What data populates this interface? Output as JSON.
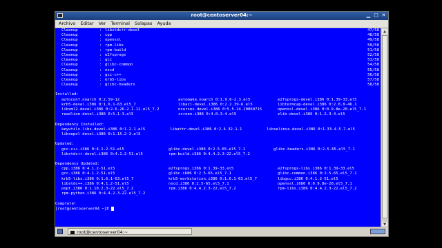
{
  "window": {
    "title": "root@centoserver04:~",
    "menu": [
      "Archivo",
      "Editar",
      "Ver",
      "Terminal",
      "Solapas",
      "Ayuda"
    ]
  },
  "terminal": {
    "cleanup": [
      [
        "Cleanup",
        ":",
        "libstdc++-devel",
        "47/58"
      ],
      [
        "Cleanup",
        ":",
        "cpp",
        "48/58"
      ],
      [
        "Cleanup",
        ":",
        "openssl",
        "49/58"
      ],
      [
        "Cleanup",
        ":",
        "rpm-libs",
        "50/58"
      ],
      [
        "Cleanup",
        ":",
        "rpm-build",
        "51/58"
      ],
      [
        "Cleanup",
        ":",
        "e2fsprogs",
        "52/58"
      ],
      [
        "Cleanup",
        ":",
        "gcc",
        "53/58"
      ],
      [
        "Cleanup",
        ":",
        "glibc-common",
        "54/58"
      ],
      [
        "Cleanup",
        ":",
        "nscd",
        "55/58"
      ],
      [
        "Cleanup",
        ":",
        "gcc-c++",
        "56/58"
      ],
      [
        "Cleanup",
        ":",
        "krb5-libs",
        "57/58"
      ],
      [
        "Cleanup",
        ":",
        "glibc-headers",
        "58/58"
      ]
    ],
    "installed_header": "Installed:",
    "installed": [
      [
        "autoconf.noarch 0:2.59-12",
        "automake.noarch 0:1.9.6-2.3.el5",
        "e2fsprogs-devel.i386 0:1.39-33.el5"
      ],
      [
        "krb5-devel.i386 0:1.6.1-63.el5_7",
        "libacl-devel.i386 0:2.2.39-6.el5",
        "libtermcap-devel.i386 0:2.0.8-46.1"
      ],
      [
        "libxml2-devel.i386 0:2.6.26-2.1.12.el5_7.2",
        "ncurses-devel.i386 0:5.5-24.20060715",
        "openssl-devel.i386 0:0.9.8e-20.el5_7.1"
      ],
      [
        "readline-devel.i386 0:5.1-3.el5",
        "screen.i386 0:4.0.3-4.el5",
        "zlib-devel.i386 0:1.2.3-4.el5"
      ]
    ],
    "dep_installed_header": "Dependency Installed:",
    "dep_installed": [
      [
        "keyutils-libs-devel.i386 0:1.2-1.el5",
        "libattr-devel.i386 0:2.4.32-1.1",
        "libselinux-devel.i386 0:1.33.4-5.7.el5"
      ],
      [
        "libsepol-devel.i386 0:1.15.2-3.el5",
        "",
        ""
      ]
    ],
    "updated_header": "Updated:",
    "updated": [
      [
        "gcc-c++.i386 0:4.1.2-51.el5",
        "glibc-devel.i386 0:2.5-65.el5_7.1",
        "glibc-headers.i386 0:2.5-65.el5_7.1"
      ],
      [
        "libstdc++-devel.i386 0:4.1.2-51.el5",
        "rpm-build.i386 0:4.4.2.3-22.el5_7.2",
        ""
      ]
    ],
    "dep_updated_header": "Dependency Updated:",
    "dep_updated": [
      [
        "cpp.i386 0:4.1.2-51.el5",
        "e2fsprogs.i386 0:1.39-33.el5",
        "e2fsprogs-libs.i386 0:1.39-33.el5"
      ],
      [
        "gcc.i386 0:4.1.2-51.el5",
        "glibc.i686 0:2.5-65.el5_7.1",
        "glibc-common.i386 0:2.5-65.el5_7.1"
      ],
      [
        "krb5-libs.i386 0:1.6.1-63.el5_7",
        "krb5-workstation.i386 0:1.6.1-63.el5_7",
        "libgcc.i386 0:4.1.2-51.el5"
      ],
      [
        "libstdc++.i386 0:4.1.2-51.el5",
        "nscd.i386 0:2.5-65.el5_7.1",
        "openssl.i686 0:0.9.8e-20.el5_7.1"
      ],
      [
        "popt.i386 0:1.10.2.3-22.el5_7.2",
        "rpm.i386 0:4.4.2.3-22.el5_7.2",
        "rpm-libs.i386 0:4.4.2.3-22.el5_7.2"
      ],
      [
        "rpm-python.i386 0:4.4.2.3-22.el5_7.2",
        "",
        ""
      ]
    ],
    "complete": "Complete!",
    "prompt": "[root@centoserver04 ~]# "
  },
  "taskbar": {
    "window_button": "root@centoserver04:~"
  }
}
